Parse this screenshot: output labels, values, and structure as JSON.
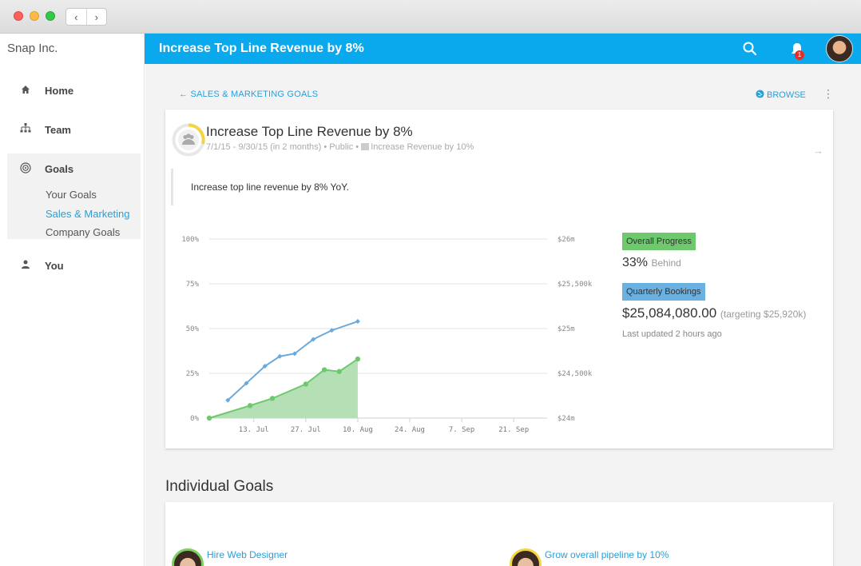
{
  "sidebar": {
    "org": "Snap Inc.",
    "items": [
      {
        "label": "Home",
        "icon": "home-icon"
      },
      {
        "label": "Team",
        "icon": "org-chart-icon"
      },
      {
        "label": "Goals",
        "icon": "target-icon"
      },
      {
        "label": "You",
        "icon": "person-icon"
      }
    ],
    "goals_sub": [
      "Your Goals",
      "Sales & Marketing",
      "Company Goals"
    ]
  },
  "header": {
    "title": "Increase Top Line Revenue by 8%",
    "notification_count": "1"
  },
  "nav": {
    "back": "‹",
    "forward": "›"
  },
  "main": {
    "breadcrumb": "SALES & MARKETING GOALS",
    "browse": "BROWSE",
    "goal": {
      "title": "Increase Top Line Revenue by 8%",
      "meta": "7/1/15 - 9/30/15 (in 2 months) • Public • ",
      "parent": "Increase Revenue by 10%",
      "description": "Increase top line revenue by 8% YoY."
    },
    "overall_progress": {
      "label": "Overall Progress",
      "value": "33%",
      "status": "Behind"
    },
    "quarterly": {
      "label": "Quarterly Bookings",
      "value": "$25,084,080.00",
      "target": "(targeting $25,920k)",
      "updated": "Last updated 2 hours ago"
    },
    "section_title": "Individual Goals",
    "individual_goals": [
      "Hire Web Designer",
      "Grow overall pipeline by 10%"
    ]
  },
  "colors": {
    "accent": "#0aa9ee",
    "link": "#2a9fd8",
    "progress_green": "#6ec86e",
    "bookings_blue": "#6ab0e0"
  },
  "chart_data": {
    "type": "line",
    "x_ticks": [
      "13. Jul",
      "27. Jul",
      "10. Aug",
      "24. Aug",
      "7. Sep",
      "21. Sep"
    ],
    "y_left_ticks": [
      "100%",
      "75%",
      "50%",
      "25%",
      "0%"
    ],
    "y_right_ticks": [
      "$26m",
      "$25,500k",
      "$25m",
      "$24,500k",
      "$24m"
    ],
    "y_left_range": [
      0,
      100
    ],
    "x_date_range": [
      "2015-07-01",
      "2015-09-30"
    ],
    "series": [
      {
        "kind": "area",
        "color": "#6ec86e",
        "points": [
          [
            "2015-07-01",
            0
          ],
          [
            "2015-07-12",
            7
          ],
          [
            "2015-07-18",
            11
          ],
          [
            "2015-07-27",
            19
          ],
          [
            "2015-08-01",
            27
          ],
          [
            "2015-08-05",
            26
          ],
          [
            "2015-08-10",
            33
          ]
        ]
      },
      {
        "kind": "line",
        "color": "#6aa9dc",
        "points": [
          [
            "2015-07-06",
            10
          ],
          [
            "2015-07-11",
            19.5
          ],
          [
            "2015-07-16",
            29
          ],
          [
            "2015-07-20",
            34.5
          ],
          [
            "2015-07-24",
            36
          ],
          [
            "2015-07-29",
            44
          ],
          [
            "2015-08-03",
            49
          ],
          [
            "2015-08-10",
            54
          ]
        ]
      }
    ]
  }
}
